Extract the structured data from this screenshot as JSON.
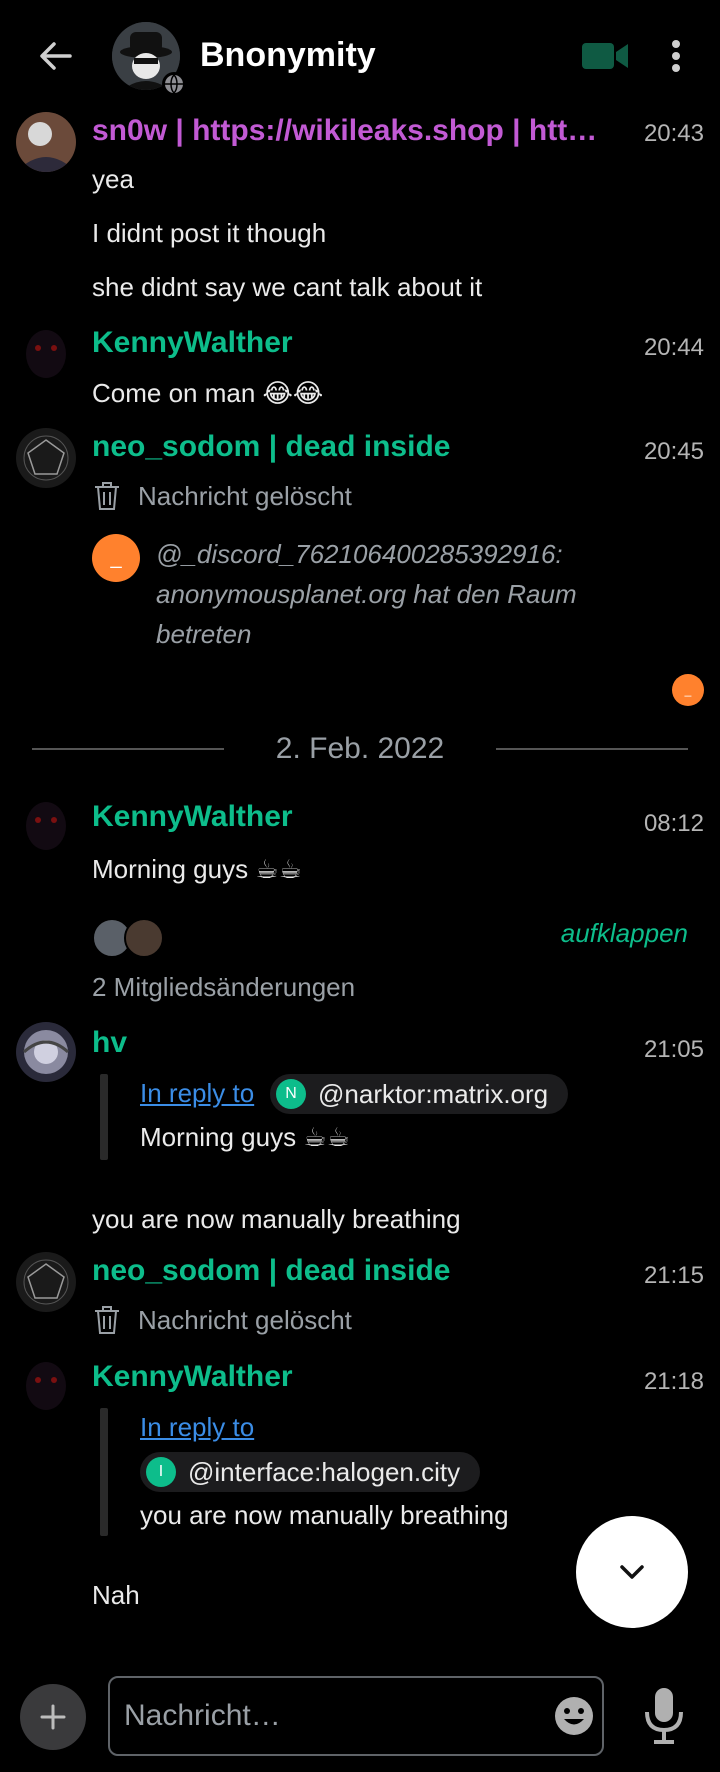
{
  "room": {
    "title": "Bnonymity"
  },
  "messages": [
    {
      "sender": "sn0w | https://wikileaks.shop | http…",
      "sender_color": "#c25ad4",
      "time": "20:43",
      "lines": [
        "yea",
        "I didnt post it though",
        "she didnt say we cant talk about it"
      ]
    },
    {
      "sender": "KennyWalther",
      "sender_color": "#0dbd8b",
      "time": "20:44",
      "lines": [
        "Come on man 😂😂"
      ]
    },
    {
      "sender": "neo_sodom | dead inside",
      "sender_color": "#0dbd8b",
      "time": "20:45",
      "deleted": "Nachricht gelöscht",
      "notice": {
        "avatar": "_",
        "text": "@_discord_762106400285392916: anonymousplanet.org hat den Raum betreten"
      },
      "read_receipt": "_"
    }
  ],
  "date_divider": "2. Feb. 2022",
  "messages2": [
    {
      "sender": "KennyWalther",
      "sender_color": "#0dbd8b",
      "time": "08:12",
      "lines": [
        "Morning guys ☕☕"
      ]
    },
    {
      "member_changes": "2 Mitgliedsänderungen",
      "expand": "aufklappen"
    },
    {
      "sender": "hv",
      "sender_color": "#0dbd8b",
      "time": "21:05",
      "reply": {
        "link": "In reply to",
        "pill_letter": "N",
        "pill_user": "@narktor:matrix.org",
        "quoted": "Morning guys ☕☕"
      },
      "text": "you are now manually breathing"
    },
    {
      "sender": "neo_sodom | dead inside",
      "sender_color": "#0dbd8b",
      "time": "21:15",
      "deleted": "Nachricht gelöscht"
    },
    {
      "sender": "KennyWalther",
      "sender_color": "#0dbd8b",
      "time": "21:18",
      "reply": {
        "link": "In reply to",
        "pill_letter": "I",
        "pill_user": "@interface:halogen.city",
        "quoted": "you are now manually breathing"
      },
      "text": "Nah"
    }
  ],
  "composer": {
    "placeholder": "Nachricht…"
  },
  "icons": [
    "back-arrow-icon",
    "globe-icon",
    "video-call-icon",
    "more-vert-icon",
    "trash-icon",
    "chevron-down-icon",
    "plus-icon",
    "emoji-icon",
    "microphone-icon"
  ]
}
